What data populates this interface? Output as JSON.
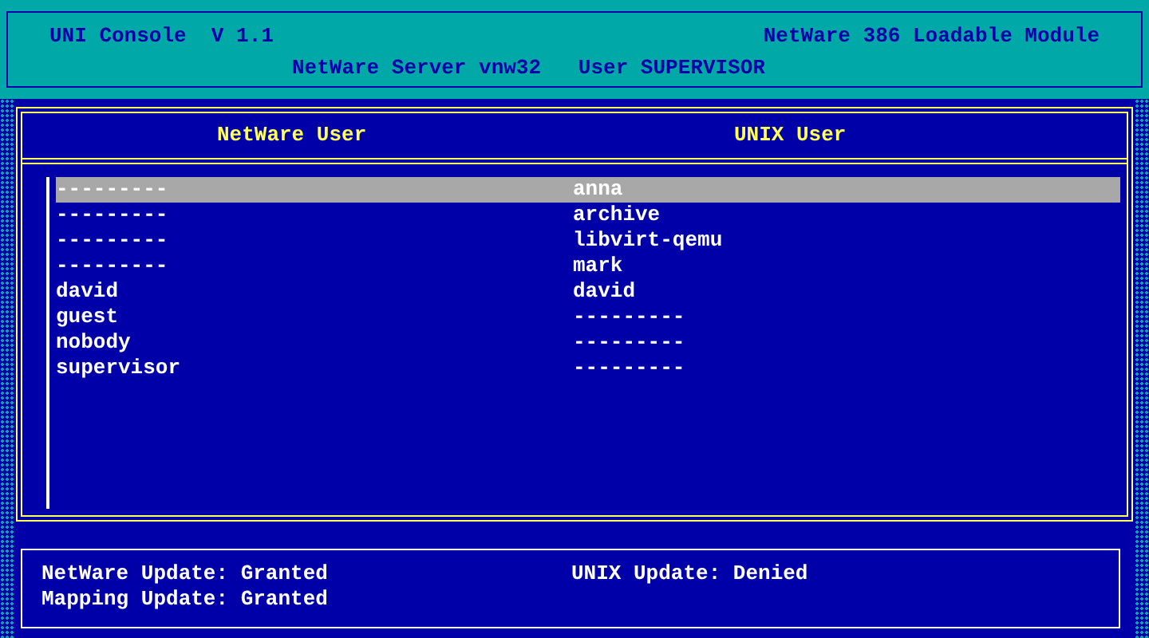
{
  "header": {
    "title": "UNI Console  V 1.1",
    "module": "NetWare 386 Loadable Module",
    "server": "NetWare Server vnw32   User SUPERVISOR"
  },
  "table": {
    "columns": [
      "NetWare User",
      "UNIX User"
    ],
    "rows": [
      {
        "netware_user": "---------",
        "unix_user": "anna",
        "selected": true
      },
      {
        "netware_user": "---------",
        "unix_user": "archive",
        "selected": false
      },
      {
        "netware_user": "---------",
        "unix_user": "libvirt-qemu",
        "selected": false
      },
      {
        "netware_user": "---------",
        "unix_user": "mark",
        "selected": false
      },
      {
        "netware_user": "david",
        "unix_user": "david",
        "selected": false
      },
      {
        "netware_user": "guest",
        "unix_user": "---------",
        "selected": false
      },
      {
        "netware_user": "nobody",
        "unix_user": "---------",
        "selected": false
      },
      {
        "netware_user": "supervisor",
        "unix_user": "---------",
        "selected": false
      }
    ]
  },
  "status": {
    "left": [
      "NetWare Update: Granted",
      "Mapping Update: Granted"
    ],
    "right": [
      "UNIX Update: Denied"
    ]
  }
}
